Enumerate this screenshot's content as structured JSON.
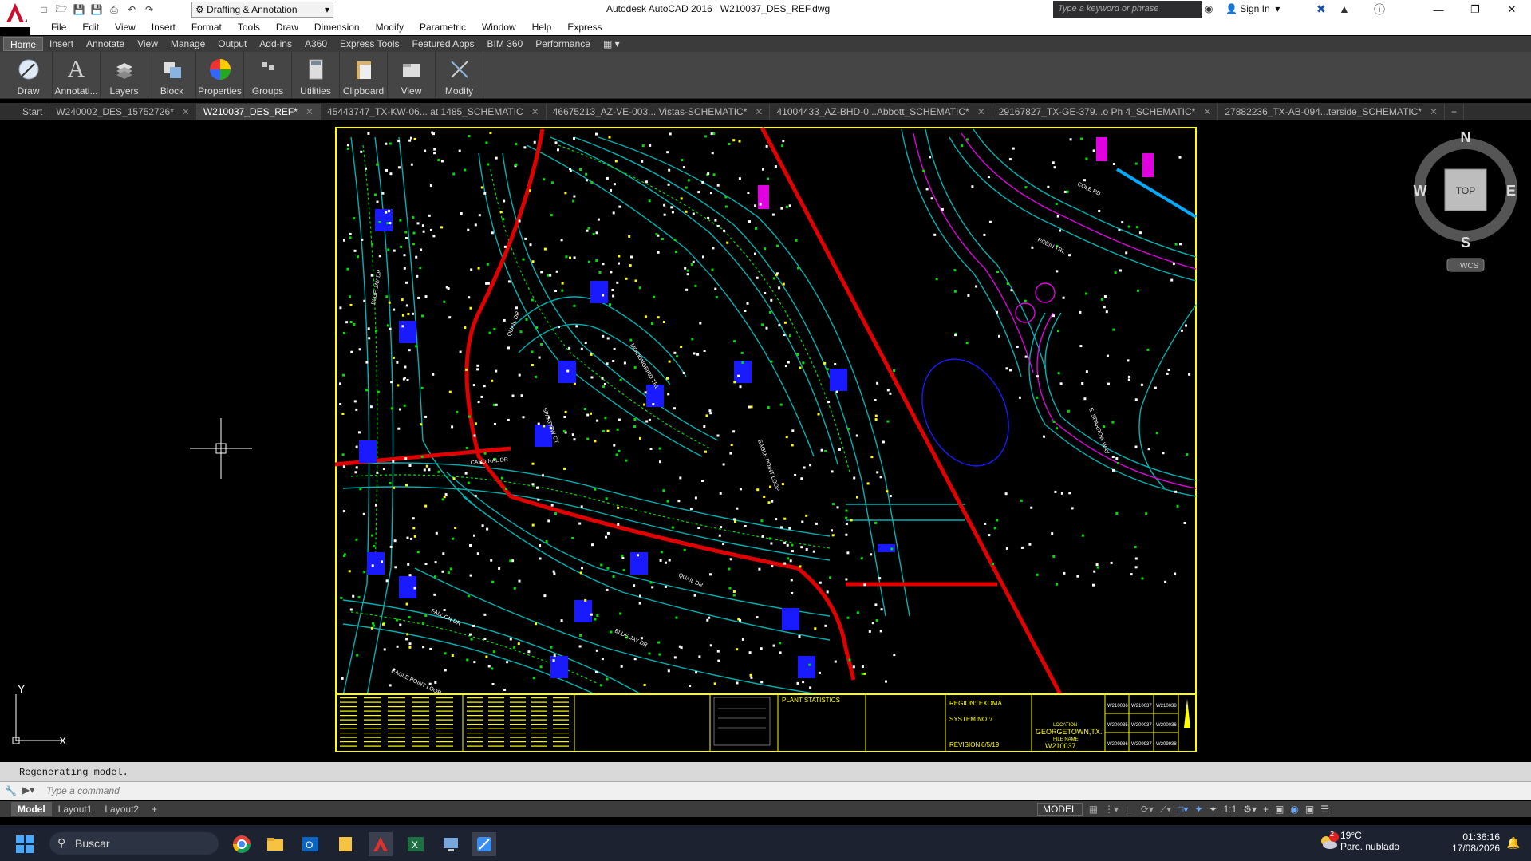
{
  "app": {
    "title": "Autodesk AutoCAD 2016",
    "filename": "W210037_DES_REF.dwg",
    "workspace": "Drafting & Annotation",
    "search_placeholder": "Type a keyword or phrase",
    "signin": "Sign In"
  },
  "menu": [
    "File",
    "Edit",
    "View",
    "Insert",
    "Format",
    "Tools",
    "Draw",
    "Dimension",
    "Modify",
    "Parametric",
    "Window",
    "Help",
    "Express"
  ],
  "ribbon_tabs": [
    "Home",
    "Insert",
    "Annotate",
    "View",
    "Manage",
    "Output",
    "Add-ins",
    "A360",
    "Express Tools",
    "Featured Apps",
    "BIM 360",
    "Performance"
  ],
  "ribbon_panels": [
    {
      "label": "Draw",
      "icon": "draw-icon"
    },
    {
      "label": "Annotati...",
      "icon": "annotation-icon"
    },
    {
      "label": "Layers",
      "icon": "layers-icon"
    },
    {
      "label": "Block",
      "icon": "block-icon"
    },
    {
      "label": "Properties",
      "icon": "properties-icon"
    },
    {
      "label": "Groups",
      "icon": "groups-icon"
    },
    {
      "label": "Utilities",
      "icon": "utilities-icon"
    },
    {
      "label": "Clipboard",
      "icon": "clipboard-icon"
    },
    {
      "label": "View",
      "icon": "view-icon"
    },
    {
      "label": "Modify",
      "icon": "modify-icon"
    }
  ],
  "file_tabs": [
    {
      "label": "Start",
      "active": false
    },
    {
      "label": "W240002_DES_15752726*",
      "active": false
    },
    {
      "label": "W210037_DES_REF*",
      "active": true
    },
    {
      "label": "45443747_TX-KW-06... at 1485_SCHEMATIC",
      "active": false
    },
    {
      "label": "46675213_AZ-VE-003... Vistas-SCHEMATIC*",
      "active": false
    },
    {
      "label": "41004433_AZ-BHD-0...Abbott_SCHEMATIC*",
      "active": false
    },
    {
      "label": "29167827_TX-GE-379...o Ph 4_SCHEMATIC*",
      "active": false
    },
    {
      "label": "27882236_TX-AB-094...terside_SCHEMATIC*",
      "active": false
    }
  ],
  "viewcube": {
    "n": "N",
    "s": "S",
    "e": "E",
    "w": "W",
    "top": "TOP",
    "wcs": "WCS"
  },
  "ucs": {
    "x": "X",
    "y": "Y"
  },
  "drawing": {
    "streets": [
      "BLUE JAY DR",
      "QUAIL DR",
      "MOCKINGBIRD TRL",
      "SPARROW CT",
      "CARDINAL DR",
      "EAGLE POINT LOOP",
      "FALCON DR",
      "QUAIL DR",
      "BLUE JAY DR",
      "EAGLE POINT LOOP",
      "COLE RD",
      "ROBIN TRL",
      "E. SPARROW WAY"
    ],
    "title_block": {
      "region_label": "REGION:",
      "region": "TEXOMA",
      "system_label": "SYSTEM NO.:",
      "system": "7",
      "revision_label": "REVISION:",
      "revision": "6/5/19",
      "plant_stats": "PLANT STATISTICS",
      "location_label": "LOCATION",
      "location": "GEORGETOWN,TX.",
      "file_label": "FILE NAME",
      "file": "W210037",
      "sheet_ids": [
        "W210036",
        "W210037",
        "W210038",
        "W200035",
        "W200037",
        "W200036",
        "W209936",
        "W209937",
        "W209938"
      ]
    }
  },
  "command": {
    "history": "Regenerating model.",
    "placeholder": "Type a command"
  },
  "layout_tabs": [
    "Model",
    "Layout1",
    "Layout2"
  ],
  "status": {
    "model": "MODEL",
    "scale": "1:1"
  },
  "taskbar": {
    "search": "Buscar",
    "weather_temp": "19°C",
    "weather_desc": "Parc. nublado",
    "time": "01:36:16",
    "date": "17/08/2026",
    "notification_count": "2"
  },
  "colors": {
    "border": "#ffff00",
    "cyan": "#00b3b3",
    "red": "#e00000",
    "blue": "#1a1aff",
    "green": "#00e000",
    "magenta": "#e000e0",
    "white": "#ffffff"
  }
}
